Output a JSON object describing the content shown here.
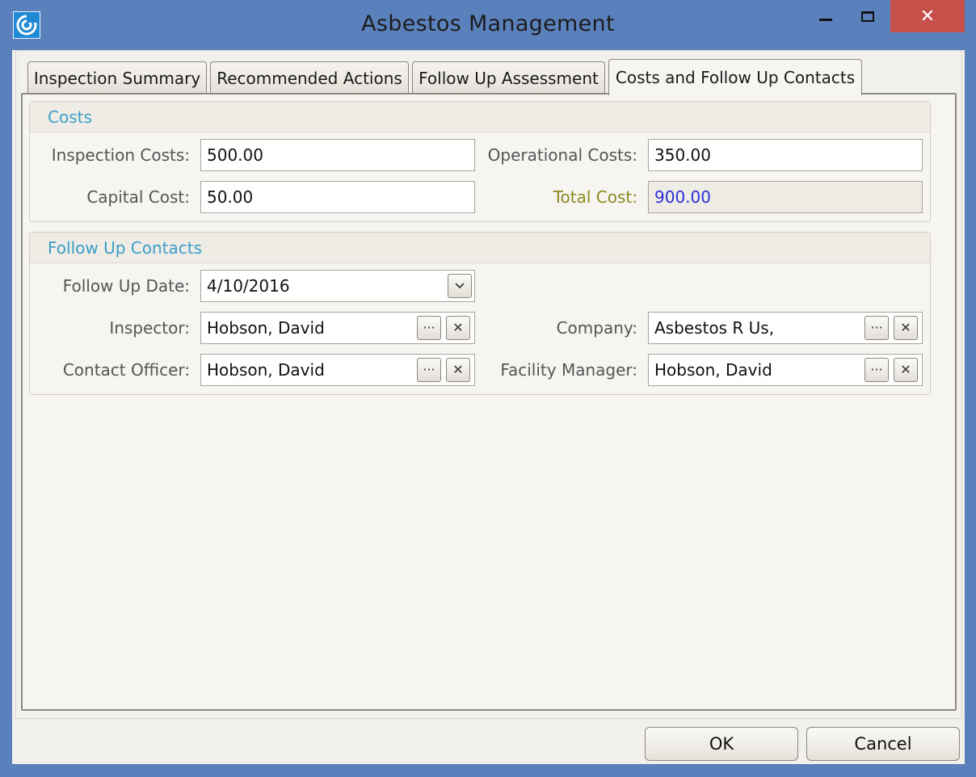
{
  "window": {
    "title": "Asbestos Management",
    "close_glyph": "✕",
    "icons": {
      "app": "app-logo-icon",
      "minimize": "minimize-icon",
      "maximize": "maximize-icon",
      "close": "close-icon"
    }
  },
  "tabs": [
    {
      "label": "Inspection Summary",
      "active": false
    },
    {
      "label": "Recommended Actions",
      "active": false
    },
    {
      "label": "Follow Up Assessment",
      "active": false
    },
    {
      "label": "Costs and Follow Up Contacts",
      "active": true
    }
  ],
  "costs": {
    "header": "Costs",
    "inspection_label": "Inspection Costs:",
    "inspection_value": "500.00",
    "operational_label": "Operational Costs:",
    "operational_value": "350.00",
    "capital_label": "Capital Cost:",
    "capital_value": "50.00",
    "total_label": "Total Cost:",
    "total_value": "900.00"
  },
  "contacts": {
    "header": "Follow Up Contacts",
    "date_label": "Follow Up Date:",
    "date_value": "4/10/2016",
    "inspector_label": "Inspector:",
    "inspector_value": "Hobson, David",
    "company_label": "Company:",
    "company_value": "Asbestos R Us,",
    "officer_label": "Contact Officer:",
    "officer_value": "Hobson, David",
    "manager_label": "Facility Manager:",
    "manager_value": "Hobson, David",
    "browse_glyph": "···",
    "clear_glyph": "✕"
  },
  "buttons": {
    "ok": "OK",
    "cancel": "Cancel"
  },
  "colors": {
    "titlebar": "#5b81bd",
    "close": "#c7504b",
    "group_header_text": "#3a9ec8",
    "total_label": "#8b8a1e",
    "total_value": "#2b2ed8"
  }
}
